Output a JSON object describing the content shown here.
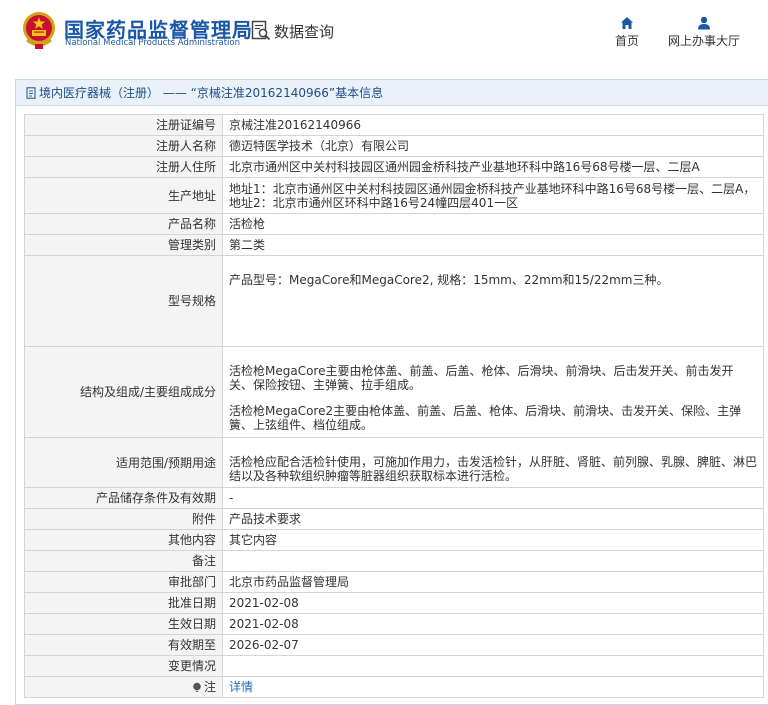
{
  "header": {
    "logo_cn": "国家药品监督管理局",
    "logo_en": "National Medical Products Administration",
    "query_label": "数据查询",
    "nav": [
      {
        "label": "首页",
        "icon": "home-icon"
      },
      {
        "label": "网上办事大厅",
        "icon": "user-icon"
      }
    ]
  },
  "breadcrumb": {
    "category": "境内医疗器械（注册）",
    "separator": "——",
    "title": "“京械注准20162140966”基本信息"
  },
  "fields": {
    "reg_no": {
      "label": "注册证编号",
      "value": "京械注准20162140966"
    },
    "registrant": {
      "label": "注册人名称",
      "value": "德迈特医学技术（北京）有限公司"
    },
    "address": {
      "label": "注册人住所",
      "value": "北京市通州区中关村科技园区通州园金桥科技产业基地环科中路16号68号楼一层、二层A"
    },
    "production": {
      "label": "生产地址",
      "value": "地址1：北京市通州区中关村科技园区通州园金桥科技产业基地环科中路16号68号楼一层、二层A，地址2：北京市通州区环科中路16号24幢四层401一区"
    },
    "product_name": {
      "label": "产品名称",
      "value": "活检枪"
    },
    "category": {
      "label": "管理类别",
      "value": "第二类"
    },
    "model": {
      "label": "型号规格",
      "value": "产品型号：MegaCore和MegaCore2, 规格：15mm、22mm和15/22mm三种。"
    },
    "structure": {
      "label": "结构及组成/主要组成成分",
      "para1": "活检枪MegaCore主要由枪体盖、前盖、后盖、枪体、后滑块、前滑块、后击发开关、前击发开关、保险按钮、主弹簧、拉手组成。",
      "para2": "活检枪MegaCore2主要由枪体盖、前盖、后盖、枪体、后滑块、前滑块、击发开关、保险、主弹簧、上弦组件、档位组成。"
    },
    "scope": {
      "label": "适用范围/预期用途",
      "value": "活检枪应配合活检针使用，可施加作用力，击发活检针，从肝脏、肾脏、前列腺、乳腺、脾脏、淋巴结以及各种软组织肿瘤等脏器组织获取标本进行活检。"
    },
    "storage": {
      "label": "产品储存条件及有效期",
      "value": "-"
    },
    "attachment": {
      "label": "附件",
      "value": "产品技术要求"
    },
    "other": {
      "label": "其他内容",
      "value": "其它内容"
    },
    "remark": {
      "label": "备注",
      "value": ""
    },
    "authority": {
      "label": "审批部门",
      "value": "北京市药品监督管理局"
    },
    "approval_date": {
      "label": "批准日期",
      "value": "2021-02-08"
    },
    "effective_date": {
      "label": "生效日期",
      "value": "2021-02-08"
    },
    "expiry_date": {
      "label": "有效期至",
      "value": "2026-02-07"
    },
    "change": {
      "label": "变更情况",
      "value": ""
    },
    "note": {
      "label": "注",
      "link": "详情"
    }
  }
}
